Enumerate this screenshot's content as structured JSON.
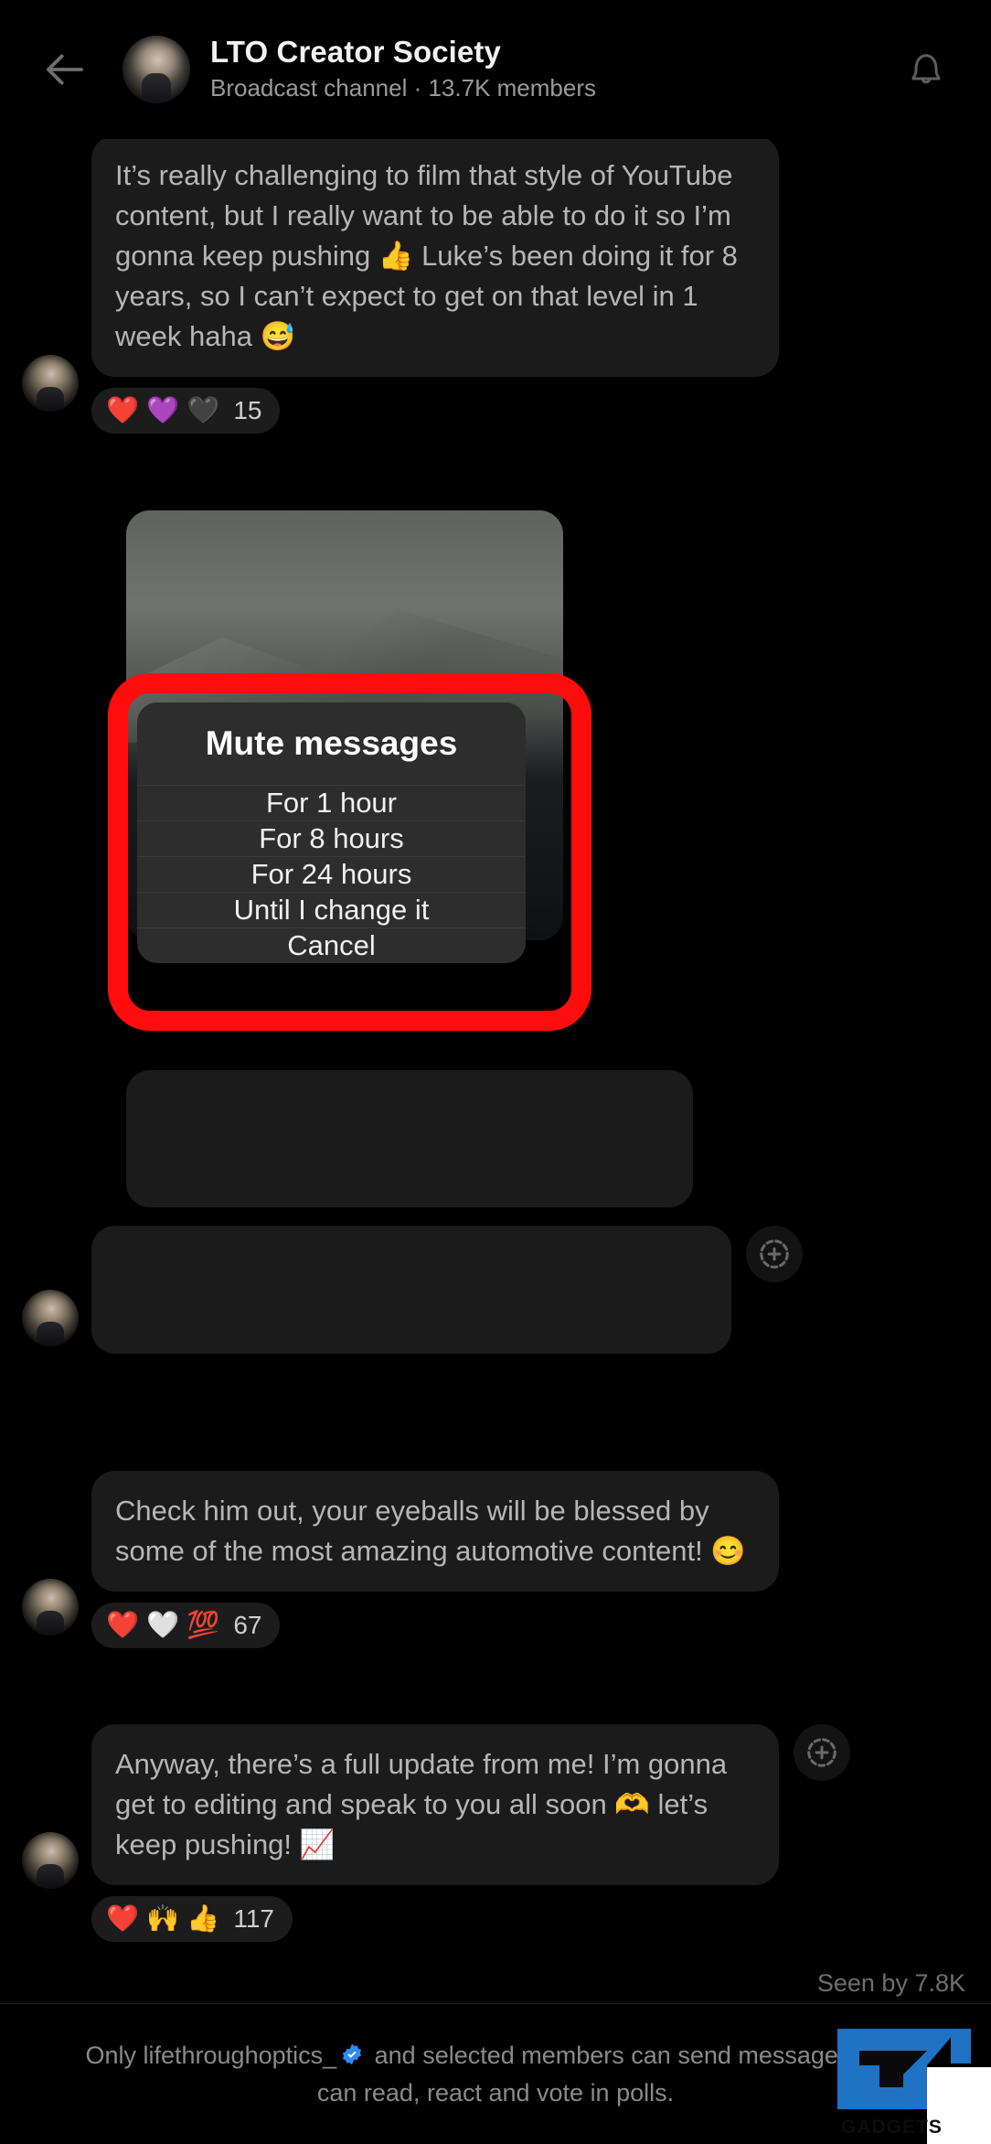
{
  "header": {
    "back_icon": "back-arrow-icon",
    "avatar": "channel-avatar",
    "title": "LTO Creator Society",
    "subtitle": "Broadcast channel · 13.7K members",
    "bell_icon": "bell-icon"
  },
  "messages": [
    {
      "id": "msg-1",
      "text": "It’s really challenging to film that style of YouTube content, but I really want to be able to do it so I’m gonna keep pushing 👍 Luke’s been doing it for 8 years, so I can’t expect to get on that level in 1 week haha 😅",
      "reactions": {
        "emojis": [
          "❤️",
          "💜",
          "🖤"
        ],
        "count": "15"
      }
    },
    {
      "id": "msg-2-photo",
      "type": "photo",
      "alt": "photo-message"
    },
    {
      "id": "msg-3",
      "text": "Check him out, your eyeballs will be blessed by some of the most amazing automotive content! 😊",
      "reactions": {
        "emojis": [
          "❤️",
          "🤍",
          "💯"
        ],
        "count": "67"
      }
    },
    {
      "id": "msg-4",
      "text": "Anyway, there’s a full update from me! I’m gonna get to editing and speak to you all soon 🫶 let’s keep pushing! 📈",
      "reactions": {
        "emojis": [
          "❤️",
          "🙌",
          "👍"
        ],
        "count": "117"
      }
    }
  ],
  "add_reaction_icon": "add-reaction-plus-icon",
  "seen_by": "Seen by 7.8K",
  "footer": {
    "text_before": "Only lifethroughoptics_",
    "verified_icon": "verified-badge-icon",
    "text_after": " and selected members can send messages. You can read, react and vote in polls."
  },
  "dialog": {
    "title": "Mute messages",
    "options": [
      {
        "label": "For 1 hour"
      },
      {
        "label": "For 8 hours"
      },
      {
        "label": "For 24 hours"
      },
      {
        "label": "Until I change it"
      },
      {
        "label": "Cancel"
      }
    ]
  },
  "highlight": {
    "color": "#ff0c0c"
  },
  "watermark": {
    "label": "GADGETS",
    "color": "#1f72c4"
  }
}
